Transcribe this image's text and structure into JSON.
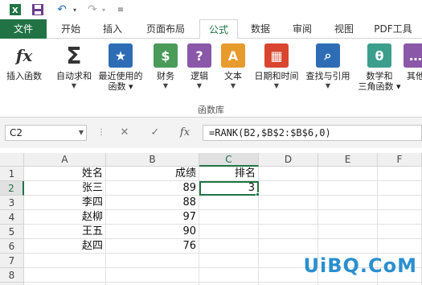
{
  "qat": {
    "save_icon": "save-icon",
    "undo_icon": "undo-icon",
    "redo_icon": "redo-icon"
  },
  "tabs": [
    "文件",
    "开始",
    "插入",
    "页面布局",
    "公式",
    "数据",
    "审阅",
    "视图",
    "PDF工具"
  ],
  "active_tab": "公式",
  "ribbon": {
    "buttons": [
      {
        "label": "插入函数",
        "icon": "fx-icon",
        "glyph": "fx",
        "color": "#ffffff",
        "fg": "#333333",
        "arrow": false
      },
      {
        "label": "自动求和",
        "icon": "sum-icon",
        "glyph": "Σ",
        "color": "#ffffff",
        "fg": "#333333",
        "arrow": true
      },
      {
        "label": "最近使用的\n函数",
        "icon": "star-icon",
        "glyph": "★",
        "color": "#2e6db5",
        "fg": "#ffffff",
        "arrow": true
      },
      {
        "label": "财务",
        "icon": "finance-icon",
        "glyph": "$",
        "color": "#4a9a5a",
        "fg": "#ffffff",
        "arrow": true
      },
      {
        "label": "逻辑",
        "icon": "logic-icon",
        "glyph": "?",
        "color": "#8b57a9",
        "fg": "#ffffff",
        "arrow": true
      },
      {
        "label": "文本",
        "icon": "text-icon",
        "glyph": "A",
        "color": "#e79b2c",
        "fg": "#ffffff",
        "arrow": true
      },
      {
        "label": "日期和时间",
        "icon": "calendar-icon",
        "glyph": "▦",
        "color": "#d9452f",
        "fg": "#ffffff",
        "arrow": true
      },
      {
        "label": "查找与引用",
        "icon": "lookup-icon",
        "glyph": "⌕",
        "color": "#2e6db5",
        "fg": "#ffffff",
        "arrow": true
      },
      {
        "label": "数学和\n三角函数",
        "icon": "math-icon",
        "glyph": "θ",
        "color": "#3c9e8c",
        "fg": "#ffffff",
        "arrow": true
      },
      {
        "label": "其他",
        "icon": "other-icon",
        "glyph": "…",
        "color": "#8b57a9",
        "fg": "#ffffff",
        "arrow": false
      }
    ],
    "group_label": "函数库"
  },
  "formula_bar": {
    "name_box": "C2",
    "cancel": "✕",
    "enter": "✓",
    "fx": "fx",
    "formula": "=RANK(B2,$B$2:$B$6,0)"
  },
  "grid": {
    "columns": [
      "A",
      "B",
      "C",
      "D",
      "E",
      "F"
    ],
    "selected_column": "C",
    "rows": [
      "1",
      "2",
      "3",
      "4",
      "5",
      "6",
      "7",
      "8",
      "9"
    ],
    "selected_row": "2",
    "cells": [
      [
        "姓名",
        "成绩",
        "排名"
      ],
      [
        "张三",
        "89",
        "3"
      ],
      [
        "李四",
        "88",
        ""
      ],
      [
        "赵柳",
        "97",
        ""
      ],
      [
        "王五",
        "90",
        ""
      ],
      [
        "赵四",
        "76",
        ""
      ]
    ]
  },
  "watermark": "UiBQ.CoM",
  "colors": {
    "accent": "#217346",
    "watermark": "#2a8fd0"
  }
}
